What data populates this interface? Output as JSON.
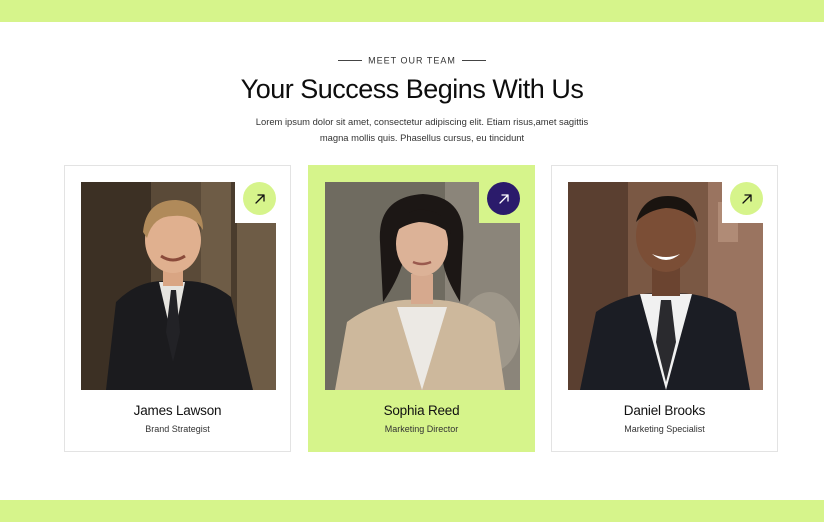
{
  "colors": {
    "accent": "#d6f48b",
    "dark_accent": "#2b1b6b",
    "text": "#111111"
  },
  "header": {
    "eyebrow": "MEET OUR TEAM",
    "title": "Your Success Begins With Us",
    "description": "Lorem ipsum dolor sit amet, consectetur adipiscing elit. Etiam risus,amet sagittis magna mollis quis. Phasellus cursus, eu tincidunt"
  },
  "team": [
    {
      "name": "James Lawson",
      "role": "Brand Strategist",
      "link_icon": "arrow-up-right-icon",
      "highlighted": false
    },
    {
      "name": "Sophia Reed",
      "role": "Marketing Director",
      "link_icon": "arrow-up-right-icon",
      "highlighted": true
    },
    {
      "name": "Daniel Brooks",
      "role": "Marketing Specialist",
      "link_icon": "arrow-up-right-icon",
      "highlighted": false
    }
  ]
}
